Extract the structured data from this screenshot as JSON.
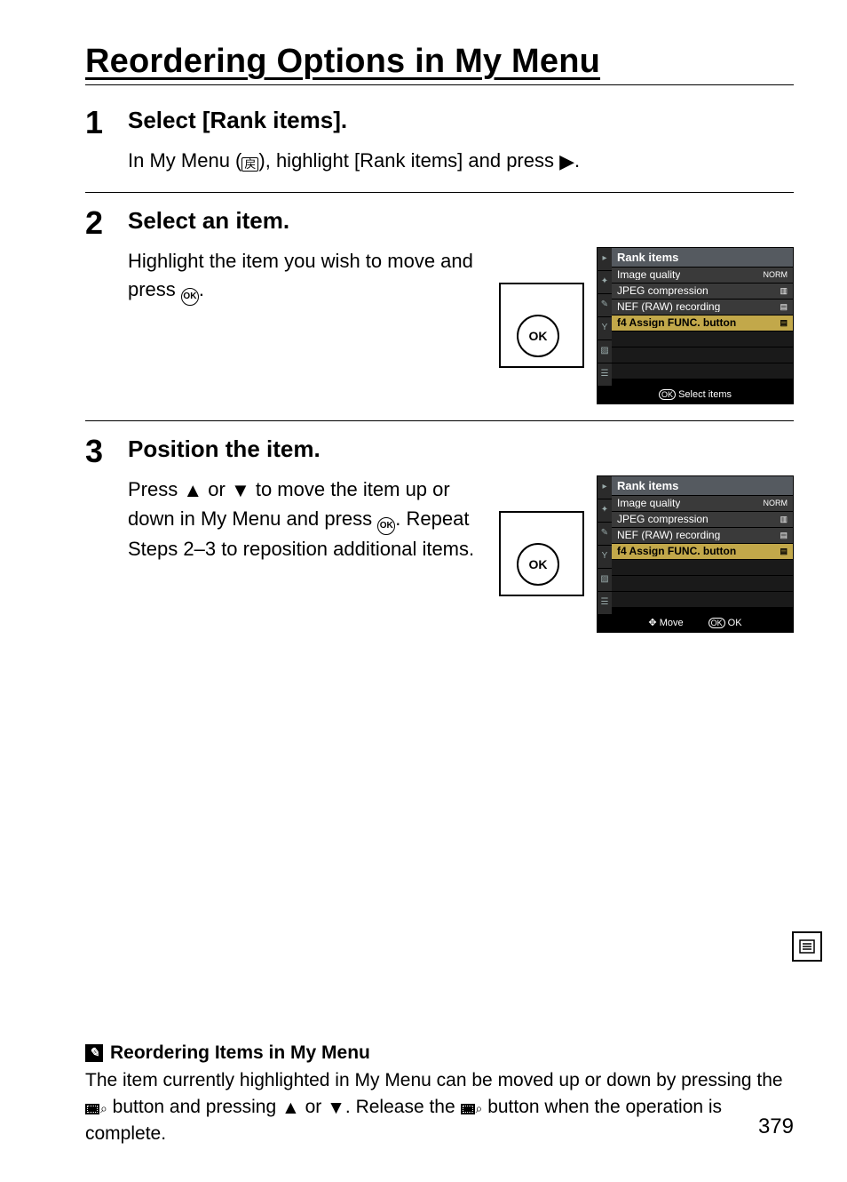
{
  "title": "Reordering Options in My Menu",
  "steps": [
    {
      "num": "1",
      "head": "Select [Rank items].",
      "para_pre": "In My Menu (",
      "para_post": "), highlight [Rank items] and press ",
      "para_end": "."
    },
    {
      "num": "2",
      "head": "Select an item.",
      "para_pre": "Highlight the item you wish to move and press ",
      "para_end": "."
    },
    {
      "num": "3",
      "head": "Position the item.",
      "para_a": "Press  ",
      "para_b": " or  ",
      "para_c": " to move the item up or down in My Menu and press ",
      "para_d": ".  Repeat Steps 2–3 to reposition additional items."
    }
  ],
  "lcd2": {
    "header": "Rank items",
    "rows": [
      {
        "label": "Image quality",
        "val": "NORM",
        "hi": false
      },
      {
        "label": "JPEG compression",
        "val": "▥",
        "hi": false
      },
      {
        "label": "NEF (RAW) recording",
        "val": "▤",
        "hi": false
      },
      {
        "label": "f4 Assign FUNC. button",
        "val": "▤",
        "hi": true
      }
    ],
    "footer_right": "Select items",
    "footer_ok": "OK"
  },
  "lcd3": {
    "header": "Rank items",
    "rows": [
      {
        "label": "Image quality",
        "val": "NORM",
        "hi": false
      },
      {
        "label": "JPEG compression",
        "val": "▥",
        "hi": false
      },
      {
        "label": "NEF (RAW) recording",
        "val": "▤",
        "hi": false
      },
      {
        "label": "f4 Assign FUNC. button",
        "val": "▤",
        "hi": true
      }
    ],
    "footer_left": "Move",
    "footer_ok": "OK",
    "footer_ok2": "OK"
  },
  "note": {
    "head": "Reordering Items in My Menu",
    "body_a": "The item currently highlighted in My Menu can be moved up or down by pressing the ",
    "body_b": " button and pressing ",
    "body_c": " or ",
    "body_d": ". Release the ",
    "body_e": " button when the operation is complete."
  },
  "page_number": "379",
  "glyph": {
    "ok": "OK",
    "mymenu": "戻"
  }
}
